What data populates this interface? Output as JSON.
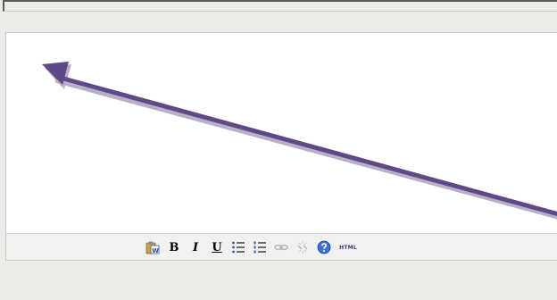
{
  "top_field": {
    "value": ""
  },
  "editor": {
    "content": ""
  },
  "toolbar": {
    "buttons": [
      {
        "name": "paste-from-word-button",
        "icon": "paste-word-icon"
      },
      {
        "name": "bold-button",
        "label": "B"
      },
      {
        "name": "italic-button",
        "label": "I"
      },
      {
        "name": "underline-button",
        "label": "U"
      },
      {
        "name": "bulleted-list-button",
        "icon": "bulleted-list-icon"
      },
      {
        "name": "numbered-list-button",
        "icon": "numbered-list-icon"
      },
      {
        "name": "link-button",
        "icon": "link-icon"
      },
      {
        "name": "unlink-button",
        "icon": "unlink-icon"
      },
      {
        "name": "help-button",
        "icon": "help-icon"
      },
      {
        "name": "html-button",
        "label": "HTML"
      }
    ]
  },
  "colors": {
    "arrow": "#5e4a86",
    "toolbar_bg": "#f1f1ef",
    "page_bg": "#ecece8"
  }
}
